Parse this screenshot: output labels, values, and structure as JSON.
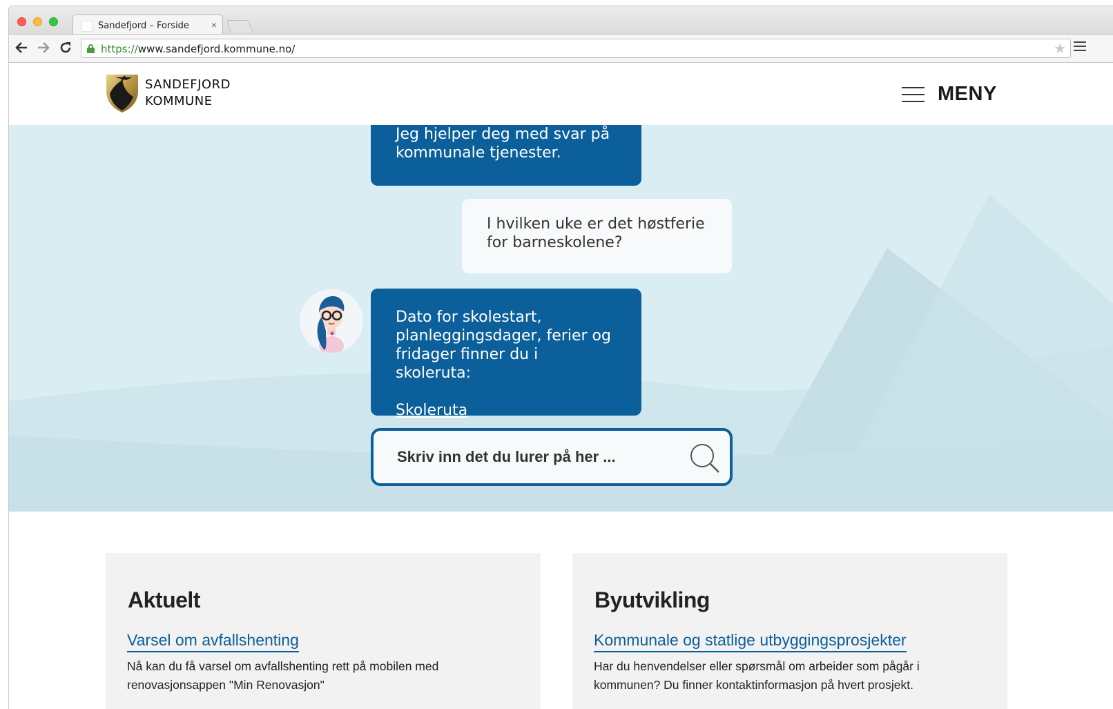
{
  "browser": {
    "tab_title": "Sandefjord – Forside",
    "tab_close": "×",
    "url_scheme": "https://",
    "url_rest": "www.sandefjord.kommune.no/"
  },
  "header": {
    "logo_line1": "SANDEFJORD",
    "logo_line2": "KOMMUNE",
    "menu_label": "MENY"
  },
  "chat": {
    "bot_message_1": "Jeg hjelper deg med svar på kommunale tjenester.",
    "user_message": "I hvilken uke er det høstferie for barneskolene?",
    "bot_message_2": "Dato for skolestart, planleggingsdager, ferier og fridager finner du i skoleruta:",
    "bot_link": "Skoleruta",
    "search_placeholder": "Skriv inn det du lurer på her ..."
  },
  "cards": [
    {
      "title": "Aktuelt",
      "link": "Varsel om avfallshenting",
      "text": "Nå kan du få varsel om avfallshenting rett på mobilen med renovasjonsappen \"Min Renovasjon\""
    },
    {
      "title": "Byutvikling",
      "link": "Kommunale og statlige utbyggingsprosjekter",
      "text": "Har du henvendelser eller spørsmål om arbeider som pågår i kommunen? Du finner kontaktinformasjon på hvert prosjekt."
    }
  ],
  "colors": {
    "brand_blue": "#0b5f9a",
    "hero_bg": "#d9edf2",
    "card_bg": "#f2f2f2"
  },
  "icons": {
    "back": "arrow-left-icon",
    "forward": "arrow-right-icon",
    "reload": "reload-icon",
    "lock": "lock-icon",
    "star": "star-icon",
    "menu": "hamburger-icon",
    "search": "search-icon"
  }
}
